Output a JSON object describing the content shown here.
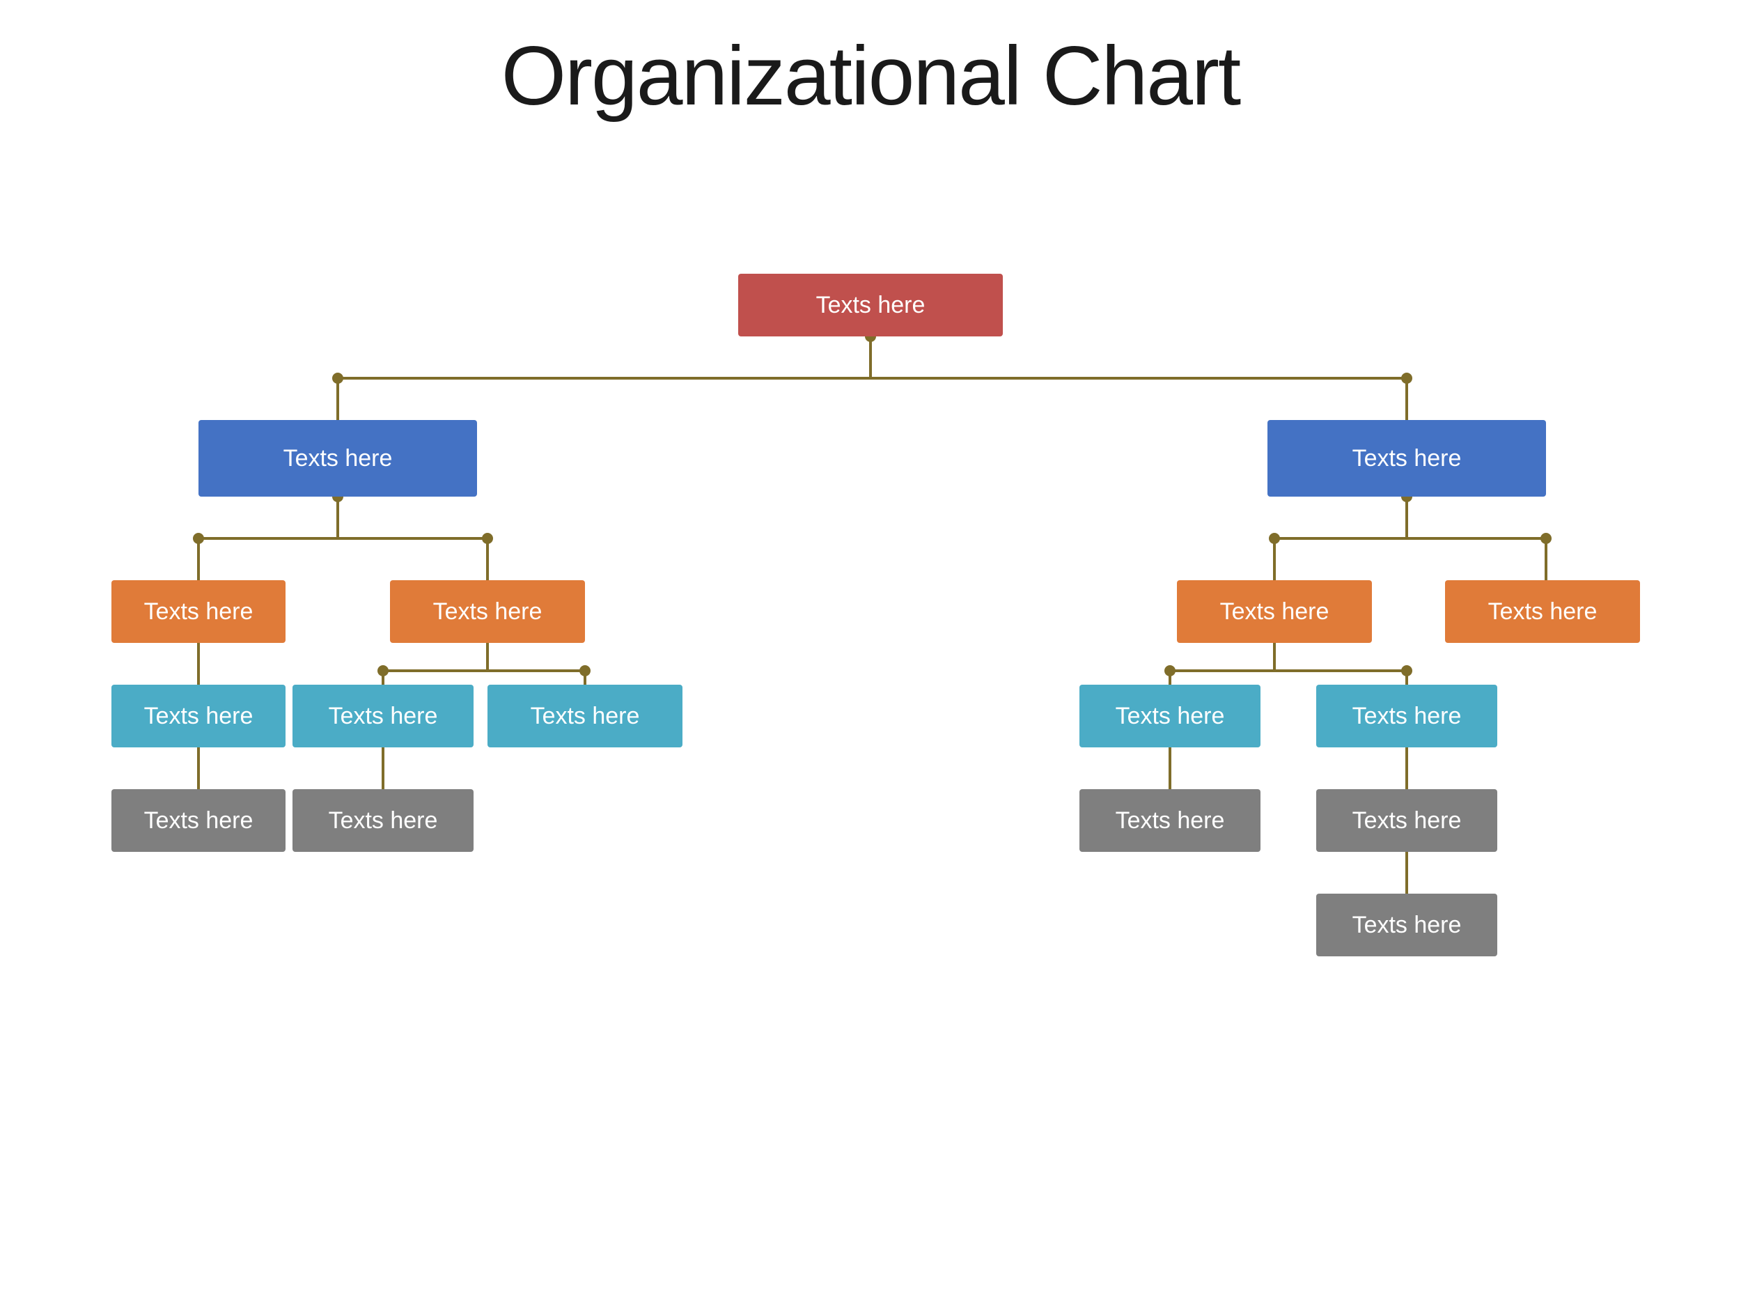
{
  "title": "Organizational Chart",
  "nodes": {
    "root": {
      "label": "Texts here",
      "color": "red"
    },
    "l1_left": {
      "label": "Texts here",
      "color": "blue"
    },
    "l1_right": {
      "label": "Texts here",
      "color": "blue"
    },
    "l2_ll": {
      "label": "Texts here",
      "color": "orange"
    },
    "l2_lr": {
      "label": "Texts here",
      "color": "orange"
    },
    "l2_rl": {
      "label": "Texts here",
      "color": "orange"
    },
    "l2_rr": {
      "label": "Texts here",
      "color": "orange"
    },
    "l3_lll": {
      "label": "Texts here",
      "color": "teal"
    },
    "l3_lrl": {
      "label": "Texts here",
      "color": "teal"
    },
    "l3_lrr": {
      "label": "Texts here",
      "color": "teal"
    },
    "l3_rll": {
      "label": "Texts here",
      "color": "teal"
    },
    "l3_rlr": {
      "label": "Texts here",
      "color": "teal"
    },
    "l4_lll": {
      "label": "Texts here",
      "color": "gray"
    },
    "l4_lrl": {
      "label": "Texts here",
      "color": "gray"
    },
    "l4_rll": {
      "label": "Texts here",
      "color": "gray"
    },
    "l4_rlr": {
      "label": "Texts here",
      "color": "gray"
    },
    "l5_rlr": {
      "label": "Texts here",
      "color": "gray"
    }
  }
}
